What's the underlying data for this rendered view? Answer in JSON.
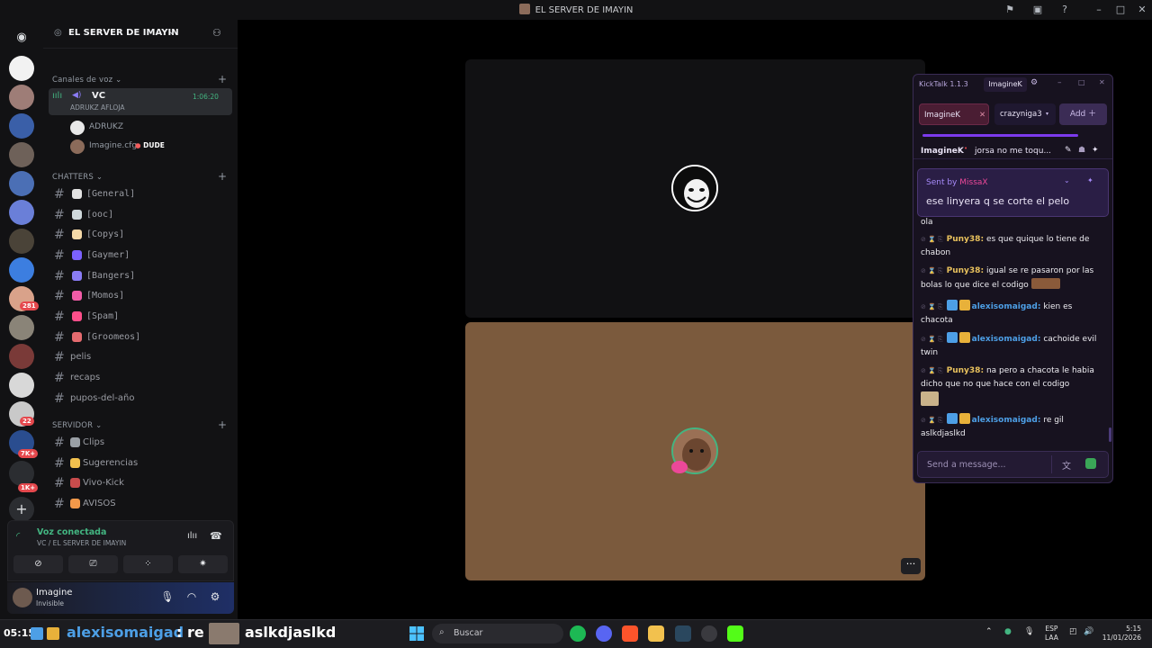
{
  "window": {
    "title": "EL SERVER DE IMAYIN"
  },
  "server": {
    "name": "EL SERVER DE IMAYIN",
    "categories": {
      "voice": "Canales de voz",
      "chatters": "CHATTERS",
      "servidor": "SERVIDOR"
    },
    "voice_channel": {
      "name": "VC",
      "status": "ADRUKZ AFLOJA",
      "timer": "1:06:20",
      "users": [
        {
          "name": "ADRUKZ",
          "tag": ""
        },
        {
          "name": "Imagine.cfg",
          "tag": "DUDE"
        }
      ]
    },
    "chatters_channels": [
      {
        "label": "[General]",
        "emoji_color": "#e2e2e2"
      },
      {
        "label": "[ooc]",
        "emoji_color": "#cfd8dc"
      },
      {
        "label": "[Copys]",
        "emoji_color": "#f5d9a8"
      },
      {
        "label": "[Gaymer]",
        "emoji_color": "#7b61ff"
      },
      {
        "label": "[Bangers]",
        "emoji_color": "#8a7cf5"
      },
      {
        "label": "[Momos]",
        "emoji_color": "#f25ca8"
      },
      {
        "label": "[Spam]",
        "emoji_color": "#ff4f8b"
      },
      {
        "label": "[Groomeos]",
        "emoji_color": "#e56b6f"
      }
    ],
    "plain_channels": [
      "pelis",
      "recaps",
      "pupos-del-año"
    ],
    "servidor_channels": [
      {
        "label": "Clips",
        "emoji_color": "#9aa0a6"
      },
      {
        "label": "Sugerencias",
        "emoji_color": "#f2c14e"
      },
      {
        "label": "Vivo-Kick",
        "emoji_color": "#c94c4c"
      },
      {
        "label": "AVISOS",
        "emoji_color": "#f2994a"
      }
    ]
  },
  "server_badges": [
    "281",
    "22",
    "7K+",
    "1K+"
  ],
  "voice_panel": {
    "title": "Voz conectada",
    "subtitle": "VC / EL SERVER DE IMAYIN"
  },
  "user_panel": {
    "name": "Imagine",
    "status": "Invisible"
  },
  "kicktalk": {
    "version": "KickTalk 1.1.3",
    "account": "ImagineK",
    "tabs": [
      {
        "label": "ImagineK"
      },
      {
        "label": "crazyniga3"
      }
    ],
    "add_label": "Add",
    "pinned": {
      "user": "ImagineK",
      "message": "jorsa no me toqu..."
    },
    "sent_card": {
      "prefix": "Sent by",
      "sender": "MissaX",
      "message": "ese linyera q se corte el pelo"
    },
    "first_line": "ola",
    "messages": [
      {
        "user": "Puny38",
        "type": "puny",
        "text": "es que quique lo tiene de chabon"
      },
      {
        "user": "Puny38",
        "type": "puny",
        "text": "igual se re pasaron por las bolas lo que dice el codigo"
      },
      {
        "user": "alexisomaigad",
        "type": "alexis",
        "text": "kien es chacota"
      },
      {
        "user": "alexisomaigad",
        "type": "alexis",
        "text": "cachoide evil twin"
      },
      {
        "user": "Puny38",
        "type": "puny",
        "text": "na pero a chacota le habia dicho que no que hace con el codigo"
      },
      {
        "user": "alexisomaigad",
        "type": "alexis",
        "text": "re gil aslkdjaslkd"
      }
    ],
    "input_placeholder": "Send a message..."
  },
  "taskbar": {
    "ticker_time": "05:15",
    "ticker_user": "alexisomaigad",
    "ticker_sep": ": re",
    "ticker_message": "aslkdjaslkd",
    "search_placeholder": "Buscar",
    "lang_top": "ESP",
    "lang_bottom": "LAA",
    "clock_time": "5:15",
    "clock_date": "11/01/2026"
  },
  "colors": {
    "voice_green": "#43b581",
    "kick_purple": "#7c3aed",
    "puny_gold": "#e8c15d",
    "alexis_blue": "#4d9fe6",
    "tile_brown": "#7b5a3d"
  }
}
